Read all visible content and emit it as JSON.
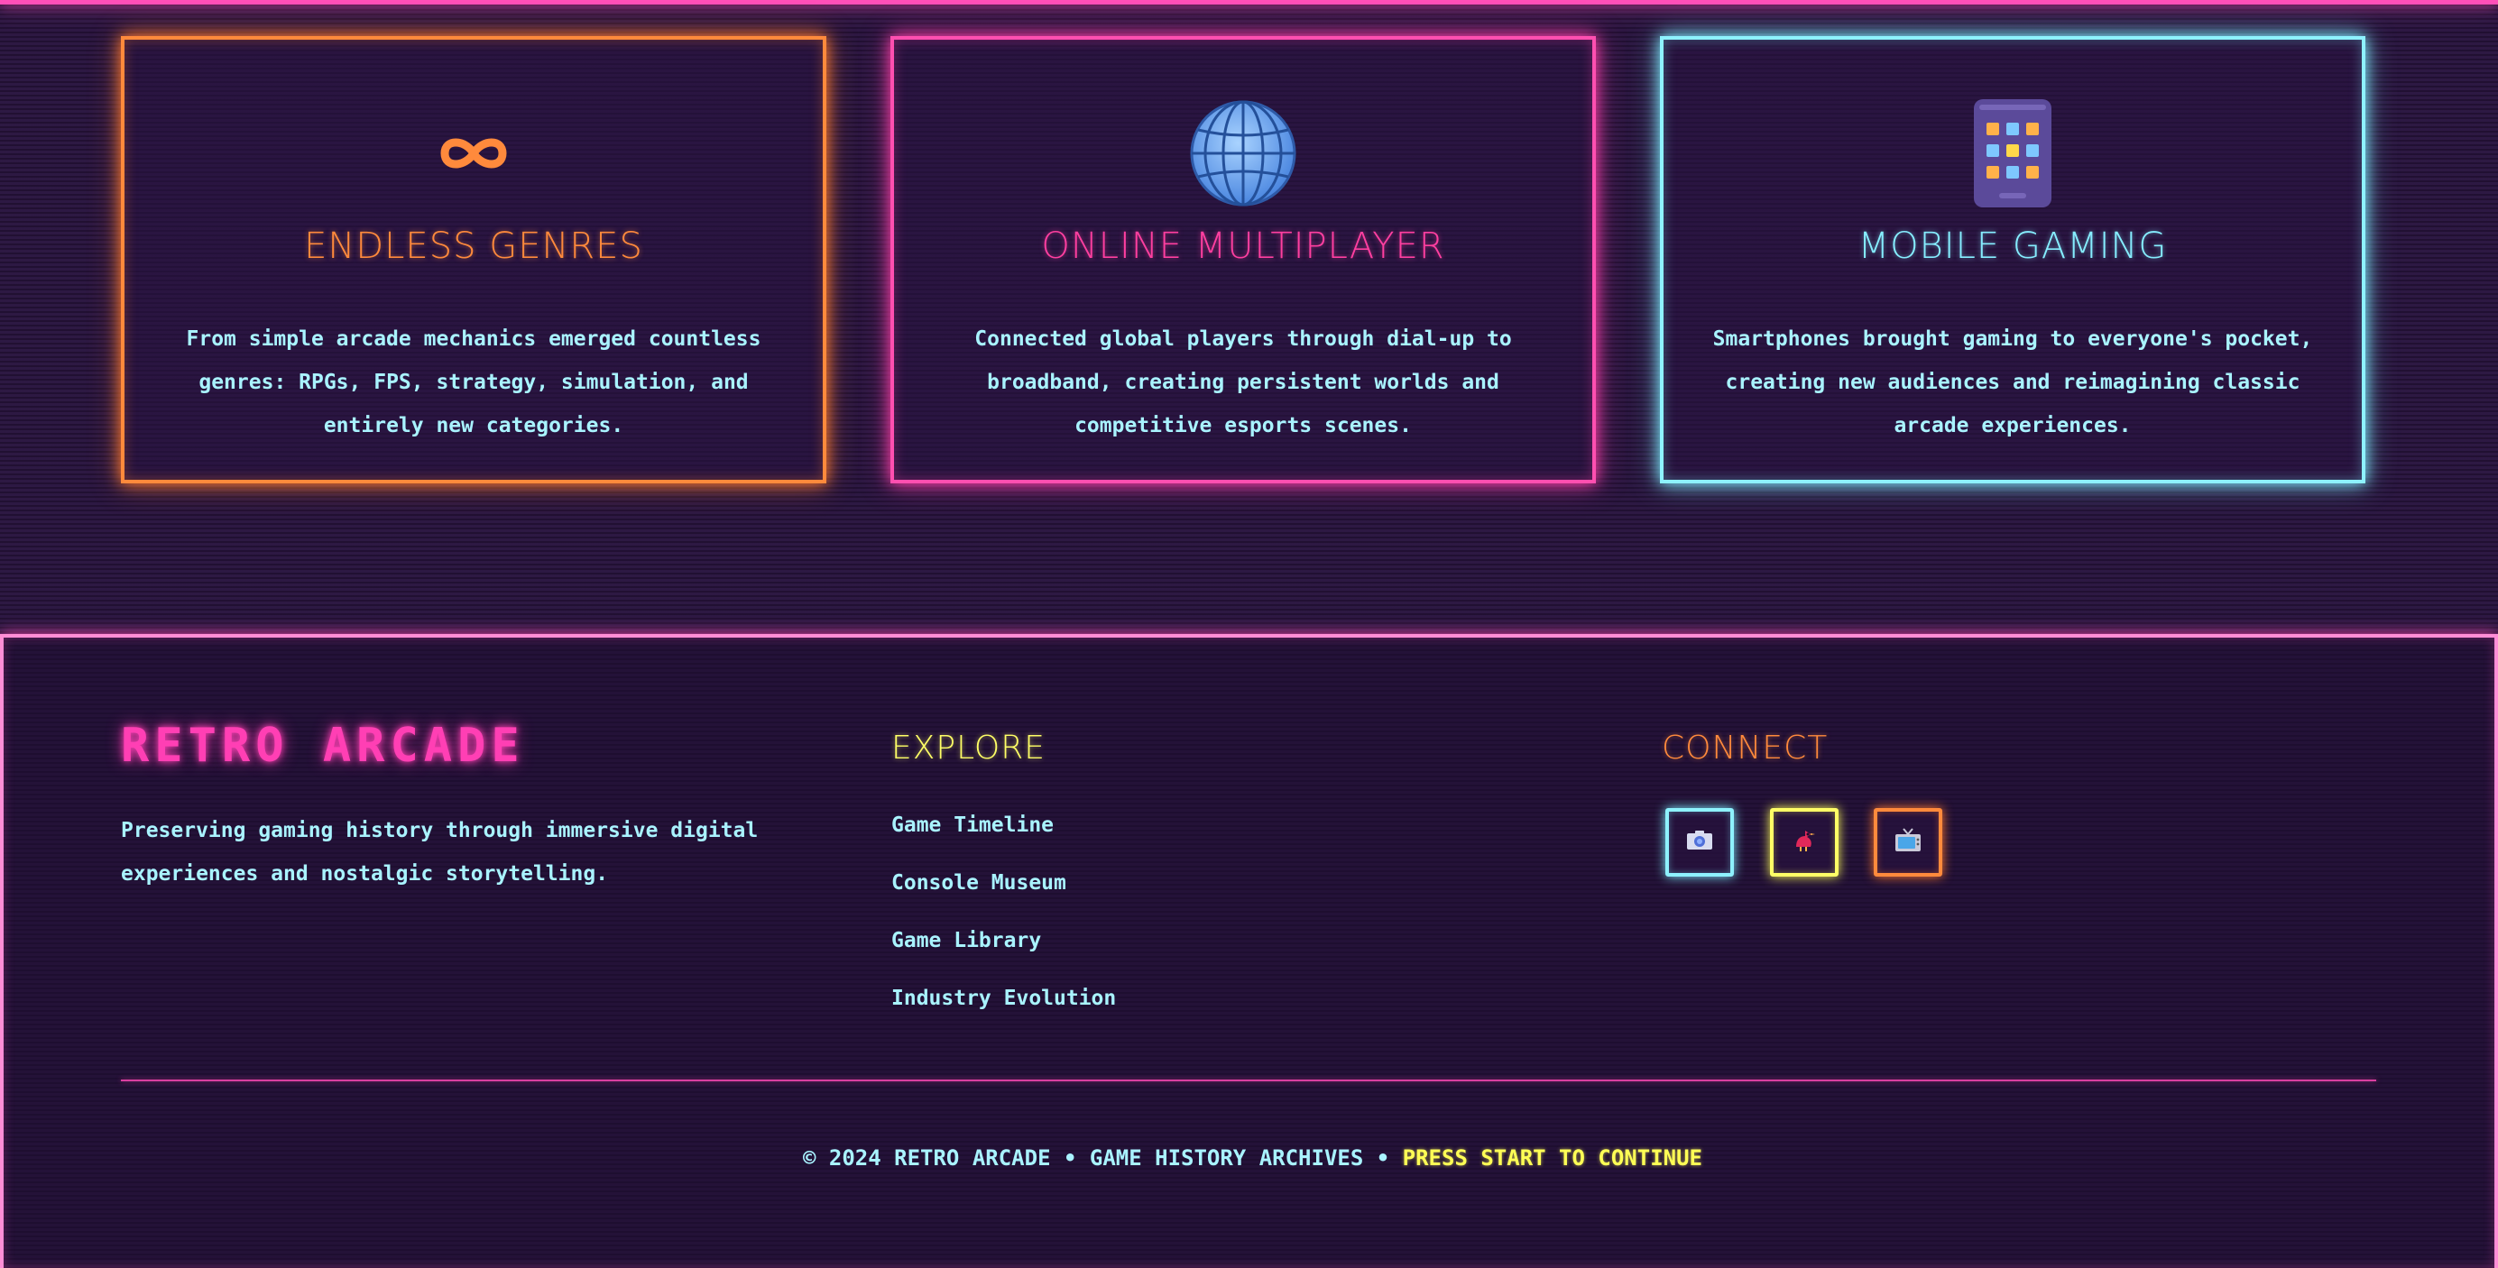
{
  "features": [
    {
      "title": "ENDLESS GENRES",
      "icon": "infinity-icon",
      "description": "From simple arcade mechanics emerged countless genres: RPGs, FPS, strategy, simulation, and entirely new categories.",
      "accent": "#ff8a3c"
    },
    {
      "title": "ONLINE MULTIPLAYER",
      "icon": "globe-icon",
      "description": "Connected global players through dial-up to broadband, creating persistent worlds and competitive esports scenes.",
      "accent": "#ff3fa0"
    },
    {
      "title": "MOBILE GAMING",
      "icon": "mobile-phone-icon",
      "description": "Smartphones brought gaming to everyone's pocket, creating new audiences and reimagining classic arcade experiences.",
      "accent": "#86eeff"
    }
  ],
  "footer": {
    "brand": "RETRO ARCADE",
    "tagline": "Preserving gaming history through immersive digital experiences and nostalgic storytelling.",
    "explore": {
      "heading": "EXPLORE",
      "links": [
        "Game Timeline",
        "Console Museum",
        "Game Library",
        "Industry Evolution"
      ]
    },
    "connect": {
      "heading": "CONNECT",
      "icons": [
        "camera-icon",
        "bird-icon",
        "television-icon"
      ]
    },
    "copyright_main": "© 2024 RETRO ARCADE • GAME HISTORY ARCHIVES • ",
    "copyright_highlight": "PRESS START TO CONTINUE"
  },
  "colors": {
    "background": "#2a1540",
    "neon_pink": "#ff4fb8",
    "neon_cyan": "#86eeff",
    "neon_yellow": "#ffff55",
    "neon_orange": "#ff8a3c"
  }
}
